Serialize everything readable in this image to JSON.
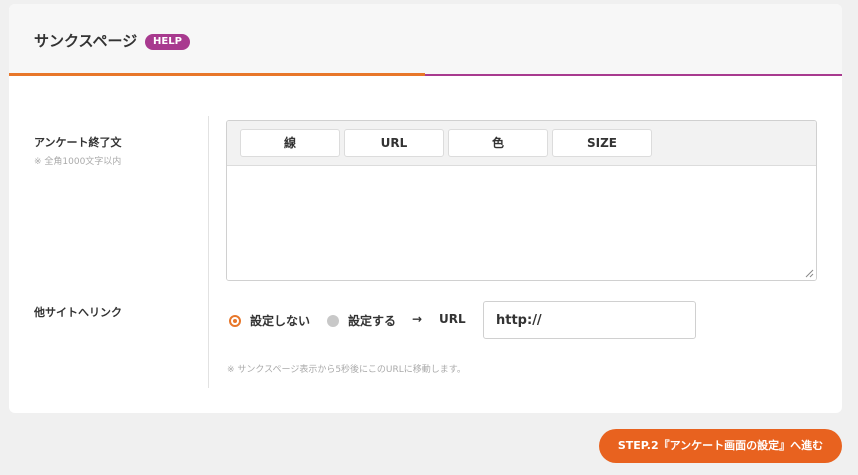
{
  "header": {
    "title": "サンクスページ",
    "help_label": "HELP"
  },
  "colors": {
    "accent_orange": "#e8772a",
    "accent_purple": "#a83a8f",
    "button_orange": "#e8621f"
  },
  "end_message": {
    "label": "アンケート終了文",
    "sublabel": "※ 全角1000文字以内",
    "toolbar": [
      {
        "label": "線"
      },
      {
        "label": "URL"
      },
      {
        "label": "色"
      },
      {
        "label": "SIZE"
      }
    ],
    "text": ""
  },
  "external_link": {
    "label": "他サイトへリンク",
    "option_off_label": "設定しない",
    "option_on_label": "設定する",
    "arrow": "→",
    "url_label": "URL",
    "url_value": "http://",
    "note": "※ サンクスページ表示から5秒後にこのURLに移動します。"
  },
  "next_button_label": "STEP.2『アンケート画面の設定』へ進む"
}
